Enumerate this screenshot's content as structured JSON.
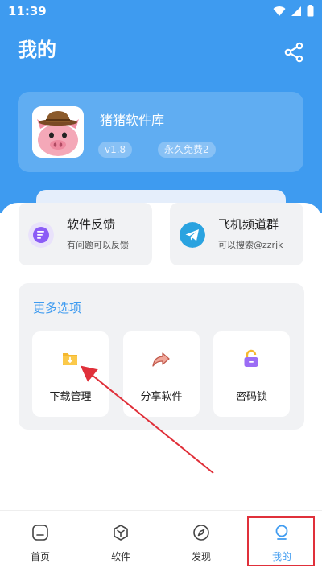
{
  "status_bar": {
    "time": "11:39"
  },
  "header": {
    "title": "我的"
  },
  "profile": {
    "app_name": "猪猪软件库",
    "version": "v1.8",
    "license": "永久免费2"
  },
  "quick_links": [
    {
      "title": "软件反馈",
      "subtitle": "有问题可以反馈"
    },
    {
      "title": "飞机频道群",
      "subtitle": "可以搜索@zzrjk"
    }
  ],
  "more_options": {
    "title": "更多选项",
    "items": [
      {
        "label": "下载管理",
        "icon": "download-folder-icon"
      },
      {
        "label": "分享软件",
        "icon": "share-arrow-icon"
      },
      {
        "label": "密码锁",
        "icon": "lock-icon"
      }
    ]
  },
  "bottom_nav": [
    {
      "label": "首页",
      "icon": "home-icon"
    },
    {
      "label": "软件",
      "icon": "cube-icon"
    },
    {
      "label": "发现",
      "icon": "compass-icon"
    },
    {
      "label": "我的",
      "icon": "profile-icon",
      "active": true
    }
  ],
  "colors": {
    "primary": "#3e9bf0",
    "annotation": "#e0303a",
    "card_bg": "#f1f2f4"
  }
}
